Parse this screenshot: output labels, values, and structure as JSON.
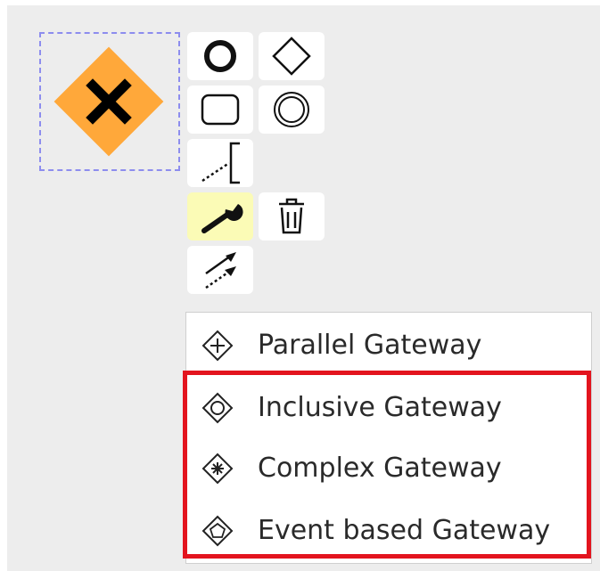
{
  "canvas": {
    "background": "#ededed"
  },
  "selected_element": {
    "type": "exclusive-gateway",
    "marker": "X",
    "fill_color": "#ffa83a",
    "selection_color": "#8d8dee"
  },
  "context_pad": {
    "items": [
      {
        "name": "end-event",
        "icon": "thick-circle-icon"
      },
      {
        "name": "gateway",
        "icon": "diamond-icon"
      },
      {
        "name": "task",
        "icon": "rounded-rect-icon"
      },
      {
        "name": "intermediate-event",
        "icon": "double-circle-icon"
      },
      {
        "name": "text-annotation",
        "icon": "annotation-icon"
      },
      {
        "name": "change-type",
        "icon": "wrench-icon",
        "highlighted": true
      },
      {
        "name": "delete",
        "icon": "trash-icon"
      },
      {
        "name": "connect",
        "icon": "connect-arrows-icon"
      }
    ],
    "highlight_color": "#fbfbb6"
  },
  "replace_menu": {
    "items": [
      {
        "label": "Parallel Gateway",
        "icon": "parallel-gateway-icon"
      },
      {
        "label": "Inclusive Gateway",
        "icon": "inclusive-gateway-icon"
      },
      {
        "label": "Complex Gateway",
        "icon": "complex-gateway-icon"
      },
      {
        "label": "Event based Gateway",
        "icon": "event-based-gateway-icon"
      }
    ]
  },
  "annotation": {
    "highlight_color": "#e3141e"
  }
}
